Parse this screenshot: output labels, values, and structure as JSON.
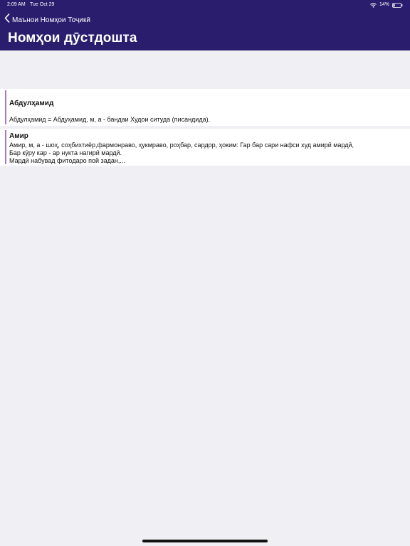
{
  "status_bar": {
    "time": "2:09 AM",
    "date": "Tue Oct 29",
    "battery": "14%"
  },
  "nav": {
    "back_label": "Маънои Номҳои Тоҷикӣ",
    "title": "Номҳои дӯстдошта"
  },
  "entries": [
    {
      "title": "Абдулҳамид",
      "body": "Абдулҳамид = Абдуҳамид, м, а - бандаи Худои ситуда (писандида)."
    },
    {
      "title": "Амир",
      "body": "Амир, м, а - шоҳ, соҳбихтиёр,фармонраво, ҳукмраво, роҳбар, сардор, ҳоким: Гар бар сари нафси худ амирӣ  мардӣ,\nБар кӯру кар - ар нукта нагирӣ мардӣ.\nМардӣ набувад фитодаро пой задан,..."
    }
  ],
  "colors": {
    "header_bg": "#2b1d6e",
    "accent_bar": "#a779c8",
    "background": "#efeff4"
  }
}
